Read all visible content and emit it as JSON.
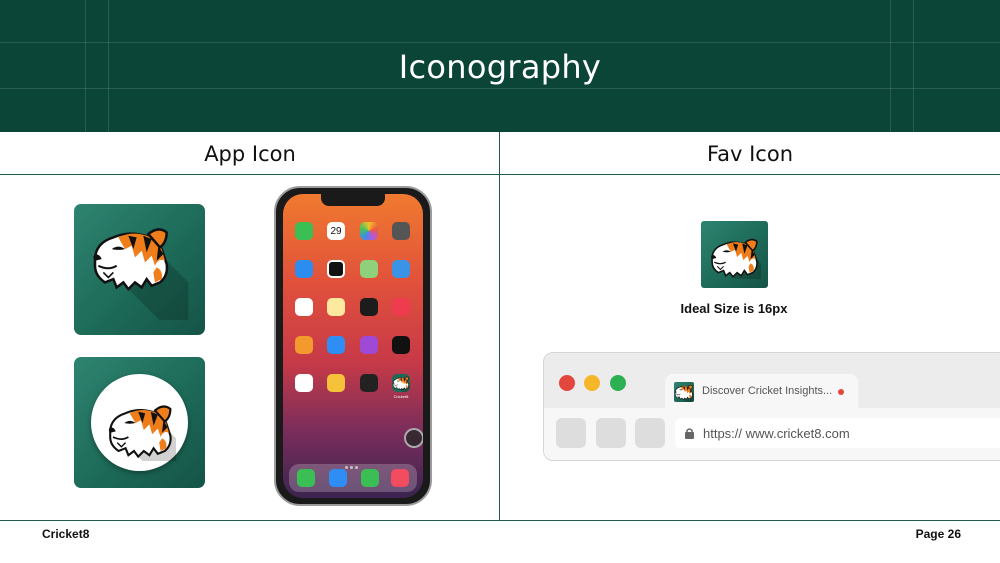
{
  "slide": {
    "title": "Iconography",
    "header_color": "#0b4538"
  },
  "sections": {
    "left_heading": "App Icon",
    "right_heading": "Fav Icon"
  },
  "app_icons": {
    "square_icon": "tiger-mascot-icon",
    "round_icon": "tiger-mascot-icon",
    "brand_color": "#1d6a58"
  },
  "phone": {
    "date_number": "29",
    "labeled_app": "Cricket8",
    "dock_apps": [
      "phone-icon",
      "safari-icon",
      "messages-icon",
      "music-icon"
    ]
  },
  "fav_icon": {
    "caption": "Ideal Size is 16px"
  },
  "browser": {
    "traffic_lights": [
      "#e2463d",
      "#f5b62a",
      "#2cb052"
    ],
    "tab_title": "Discover Cricket Insights...",
    "url": "https:// www.cricket8.com"
  },
  "footer": {
    "brand": "Cricket8",
    "page": "Page 26"
  }
}
